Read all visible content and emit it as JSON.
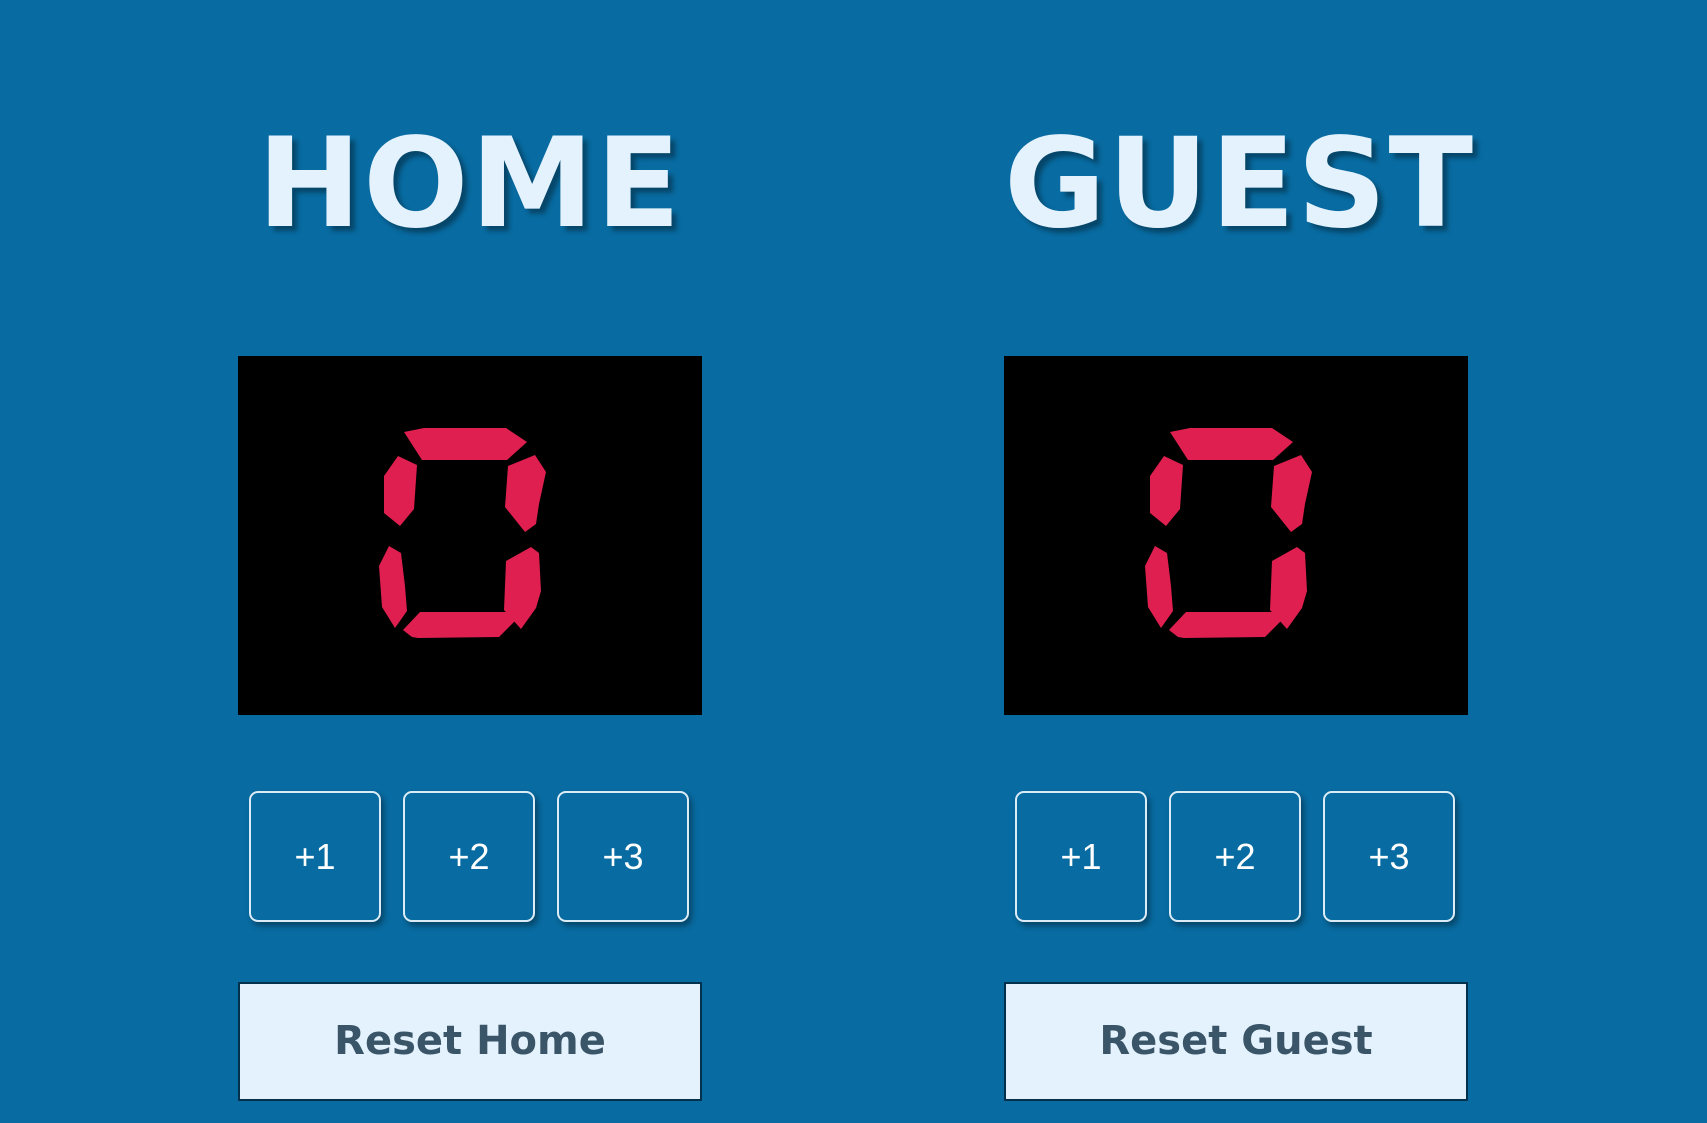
{
  "home": {
    "title": "HOME",
    "score": "0",
    "buttons": [
      "+1",
      "+2",
      "+3"
    ],
    "reset_label": "Reset Home"
  },
  "guest": {
    "title": "GUEST",
    "score": "0",
    "buttons": [
      "+1",
      "+2",
      "+3"
    ],
    "reset_label": "Reset Guest"
  },
  "colors": {
    "background": "#086ba1",
    "title_text": "#e3f2fd",
    "display_background": "#000000",
    "digit_segment": "#df1f4f",
    "reset_background": "#e3f2fd",
    "reset_text": "#3a5568"
  }
}
